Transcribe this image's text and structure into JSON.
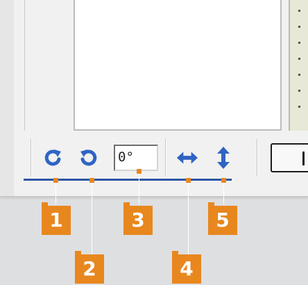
{
  "dialog": {
    "angle_field": {
      "value": "0°"
    },
    "buttons": {
      "rotate_right": {
        "icon": "rotate-clockwise-icon"
      },
      "rotate_left": {
        "icon": "rotate-counterclockwise-icon"
      },
      "flip_horizontal": {
        "icon": "flip-horizontal-icon"
      },
      "flip_vertical": {
        "icon": "flip-vertical-icon"
      }
    }
  },
  "callouts": [
    "1",
    "2",
    "3",
    "4",
    "5"
  ],
  "colors": {
    "icon_blue": "#2f64c4",
    "badge_orange": "#e8871e",
    "accent_line": "#2c56a3"
  }
}
